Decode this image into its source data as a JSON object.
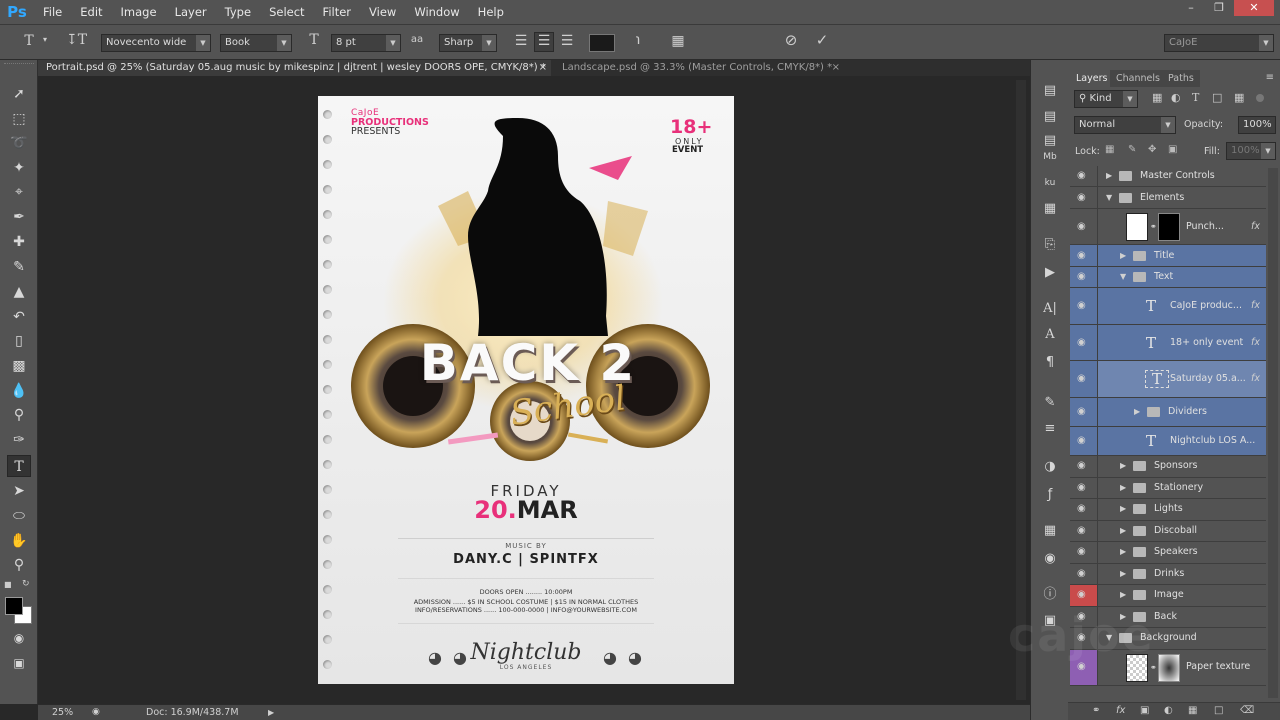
{
  "app": {
    "logo": "Ps"
  },
  "menu": [
    "File",
    "Edit",
    "Image",
    "Layer",
    "Type",
    "Select",
    "Filter",
    "View",
    "Window",
    "Help"
  ],
  "options_bar": {
    "tool_letter": "T",
    "font_family": "Novecento wide",
    "font_style": "Book",
    "font_size": "8 pt",
    "aa_label": "aa",
    "anti_alias": "Sharp",
    "workspace": "CaJoE"
  },
  "tabs": [
    {
      "label": "Portrait.psd @ 25% (Saturday 05.aug music by mikespinz | djtrent | wesley DOORS OPE, CMYK/8*) *",
      "close": "×",
      "active": true
    },
    {
      "label": "Landscape.psd @ 33.3% (Master Controls, CMYK/8*) *",
      "close": "×",
      "active": false
    }
  ],
  "poster": {
    "brand_line1": "CaJoE",
    "brand_line2": "PRODUCTIONS",
    "brand_line3": "PRESENTS",
    "age_big": "18+",
    "age_line2": "ONLY",
    "age_line3": "EVENT",
    "title_main": "BACK 2",
    "title_script": "School",
    "day": "FRIDAY",
    "date_num": "20.",
    "date_month": "MAR",
    "music_by": "MUSIC BY",
    "djs": "DANY.C | SPINTFX",
    "doors": "DOORS OPEN ........ 10:00PM",
    "admission": "ADMISSION ...... $5 IN SCHOOL COSTUME | $15 IN NORMAL CLOTHES",
    "info": "INFO/RESERVATIONS ...... 100-000-0000 | INFO@YOURWEBSITE.COM",
    "venue": "Nightclub",
    "venue_sub": "LOS ANGELES"
  },
  "status_bar": {
    "zoom": "25%",
    "doc": "Doc: 16.9M/438.7M"
  },
  "layers_panel": {
    "tabs": [
      "Layers",
      "Channels",
      "Paths"
    ],
    "filter_label": "Kind",
    "blend_mode": "Normal",
    "opacity_label": "Opacity:",
    "opacity_value": "100%",
    "lock_label": "Lock:",
    "fill_label": "Fill:",
    "fill_value": "100%",
    "watermark": "cajoe",
    "layers": [
      {
        "name": "Master Controls",
        "kind": "group",
        "indent": 0,
        "expanded": false
      },
      {
        "name": "Elements",
        "kind": "group",
        "indent": 0,
        "expanded": true
      },
      {
        "name": "Punch...",
        "kind": "smart",
        "indent": 1,
        "fx": "fx"
      },
      {
        "name": "Title",
        "kind": "group",
        "indent": 1,
        "expanded": false,
        "selected": true
      },
      {
        "name": "Text",
        "kind": "group",
        "indent": 1,
        "expanded": true,
        "selected": true
      },
      {
        "name": "CaJoE produc...",
        "kind": "text",
        "indent": 2,
        "fx": "fx",
        "selected": true
      },
      {
        "name": "18+ only event",
        "kind": "text",
        "indent": 2,
        "fx": "fx",
        "selected": true
      },
      {
        "name": "Saturday 05.a...",
        "kind": "text",
        "indent": 2,
        "fx": "fx",
        "selected": true,
        "active": true
      },
      {
        "name": "Dividers",
        "kind": "group",
        "indent": 2,
        "expanded": false,
        "selected": true
      },
      {
        "name": "Nightclub  LOS A...",
        "kind": "text",
        "indent": 2,
        "selected": true
      },
      {
        "name": "Sponsors",
        "kind": "group",
        "indent": 1,
        "expanded": false
      },
      {
        "name": "Stationery",
        "kind": "group",
        "indent": 1,
        "expanded": false
      },
      {
        "name": "Lights",
        "kind": "group",
        "indent": 1,
        "expanded": false
      },
      {
        "name": "Discoball",
        "kind": "group",
        "indent": 1,
        "expanded": false
      },
      {
        "name": "Speakers",
        "kind": "group",
        "indent": 1,
        "expanded": false
      },
      {
        "name": "Drinks",
        "kind": "group",
        "indent": 1,
        "expanded": false
      },
      {
        "name": "Image",
        "kind": "group",
        "indent": 1,
        "expanded": false,
        "eye_color": "red"
      },
      {
        "name": "Back",
        "kind": "group",
        "indent": 1,
        "expanded": false
      },
      {
        "name": "Background",
        "kind": "group",
        "indent": 0,
        "expanded": true
      },
      {
        "name": "Paper texture",
        "kind": "smart",
        "indent": 1,
        "eye_color": "purple"
      }
    ]
  },
  "colors": {
    "ui_dark": "#535353",
    "canvas_bg": "#282828",
    "selection": "#5a74a3",
    "accent_pink": "#e8307a",
    "gold": "#c8a04a"
  }
}
